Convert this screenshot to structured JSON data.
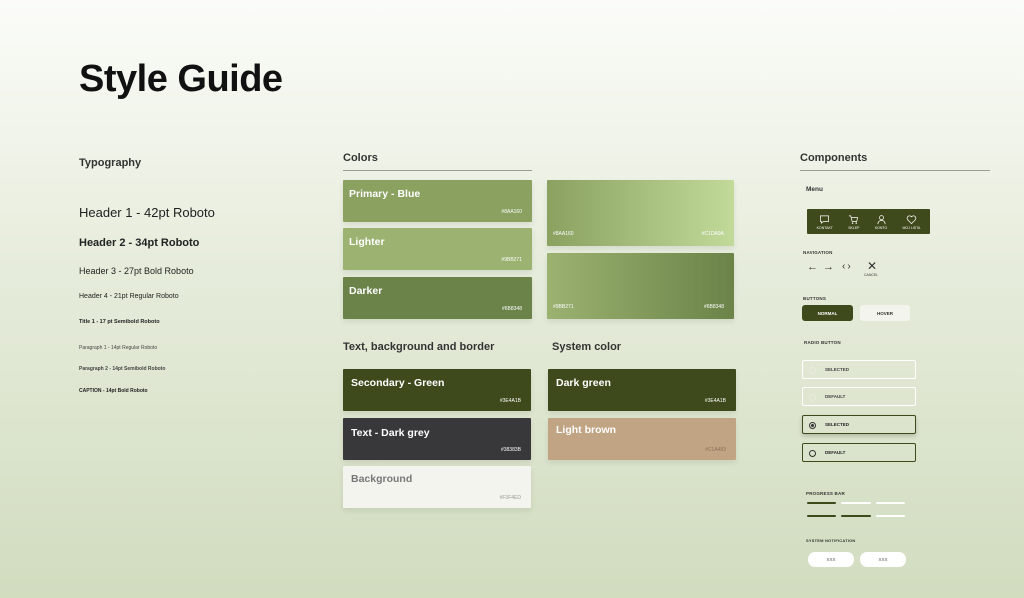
{
  "page_title": "Style Guide",
  "typography": {
    "heading": "Typography",
    "items": [
      "Header 1 - 42pt Roboto",
      "Header 2 - 34pt Roboto",
      "Header 3 - 27pt Bold Roboto",
      "Header 4 - 21pt Regular Roboto",
      "Title 1 - 17 pt Semibold Roboto",
      "Paragraph 1 - 14pt Regular Roboto",
      "Paragraph 2 - 14pt Semibold Roboto",
      "CAPTION - 14pt Bold Roboto"
    ]
  },
  "colors": {
    "heading": "Colors",
    "primary": {
      "label": "Primary - Blue",
      "hex": "#8AA160",
      "color": "#8aa160"
    },
    "lighter": {
      "label": "Lighter",
      "hex": "#9BB271",
      "color": "#9bb271"
    },
    "darker": {
      "label": "Darker",
      "hex": "#6B8348",
      "color": "#6b8348"
    },
    "grad1": {
      "hex_left": "#8AA160",
      "hex_right": "#C1DA9A"
    },
    "grad2": {
      "hex_left": "#9BB271",
      "hex_right": "#6B8348"
    }
  },
  "text_bg_border": {
    "heading": "Text, background and border",
    "secondary": {
      "label": "Secondary - Green",
      "hex": "#3E4A1B",
      "color": "#3e4a1b"
    },
    "text": {
      "label": "Text - Dark grey",
      "hex": "#38383B",
      "color": "#38383b"
    },
    "background": {
      "label": "Background",
      "hex": "#F3F4ED",
      "color": "#f3f4ed"
    }
  },
  "system_color": {
    "heading": "System color",
    "dark_green": {
      "label": "Dark green",
      "hex": "#3E4A1B",
      "color": "#3e4a1b"
    },
    "light_brown": {
      "label": "Light brown",
      "hex": "#C1A483",
      "color": "#c1a483"
    }
  },
  "components": {
    "heading": "Components",
    "menu": {
      "heading": "Menu",
      "items": [
        "KONTAKT",
        "SKLEP",
        "KONTO",
        "MOJ LISTA"
      ]
    },
    "navigation": {
      "heading": "NAVIGATION",
      "cancel_label": "CANCEL"
    },
    "buttons": {
      "heading": "BUTTONS",
      "normal": "NORMAL",
      "hover": "HOVER"
    },
    "radio": {
      "heading": "RADIO BUTTON",
      "items": [
        "SELECTED",
        "DEFAULT",
        "SELECTED",
        "DEFAULT"
      ]
    },
    "progress": {
      "heading": "PROGRESS BAR"
    },
    "notification": {
      "heading": "SYSTEM NOTIFICATION",
      "pills": [
        "XXX",
        "XXX"
      ]
    }
  }
}
